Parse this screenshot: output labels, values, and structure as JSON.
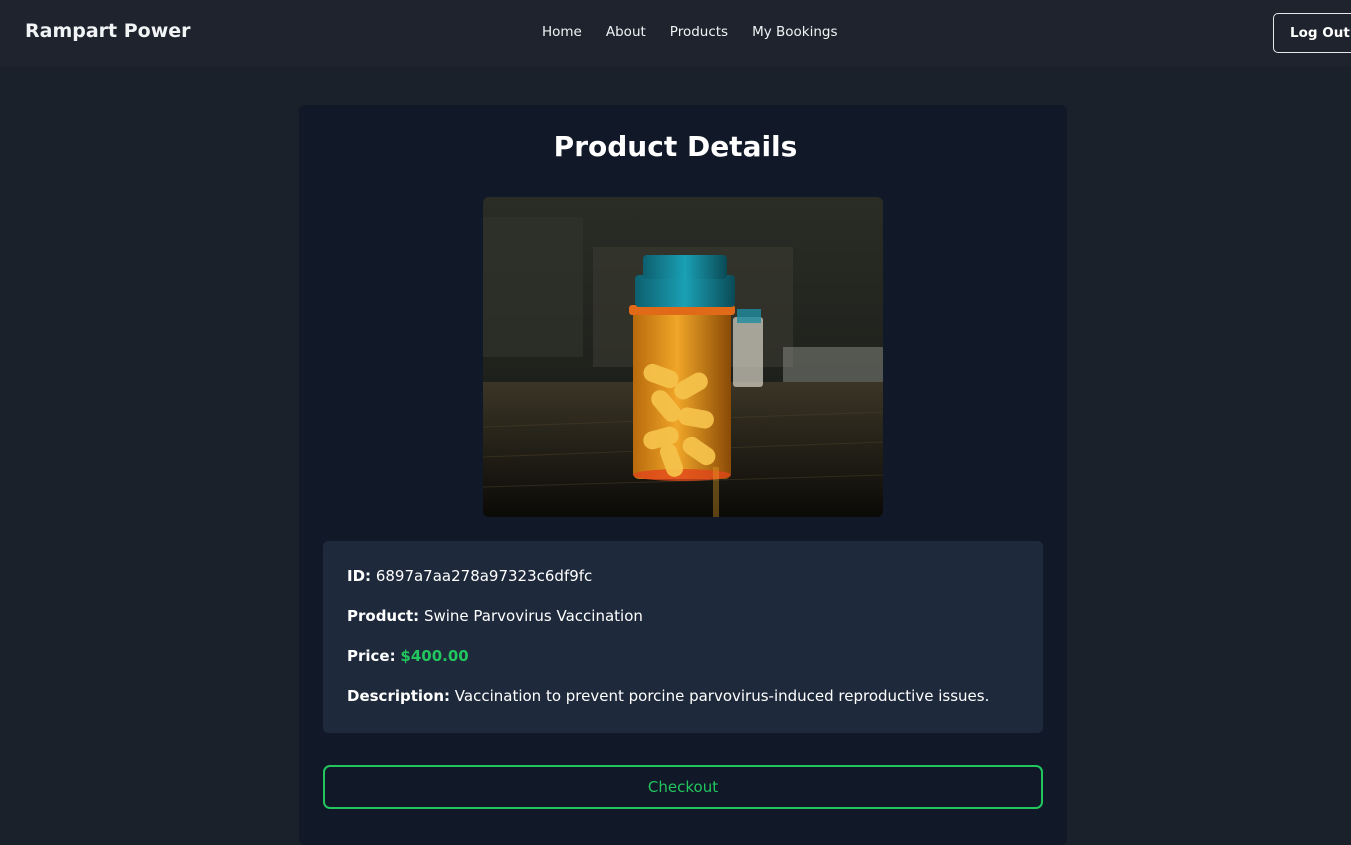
{
  "nav": {
    "brand": "Rampart Power",
    "links": [
      "Home",
      "About",
      "Products",
      "My Bookings"
    ],
    "logout_label": "Log Out"
  },
  "page": {
    "title": "Product Details"
  },
  "product": {
    "image_icon": "pill-bottle-photo",
    "id_label": "ID:",
    "id_value": "6897a7aa278a97323c6df9fc",
    "name_label": "Product:",
    "name_value": "Swine Parvovirus Vaccination",
    "price_label": "Price:",
    "price_value": "$400.00",
    "description_label": "Description:",
    "description_value": "Vaccination to prevent porcine parvovirus-induced reproductive issues."
  },
  "actions": {
    "checkout_label": "Checkout"
  },
  "colors": {
    "background": "#1b212b",
    "navbar": "#1e232d",
    "card": "#111827",
    "info_box": "#1e293b",
    "accent_green": "#22c55e"
  }
}
